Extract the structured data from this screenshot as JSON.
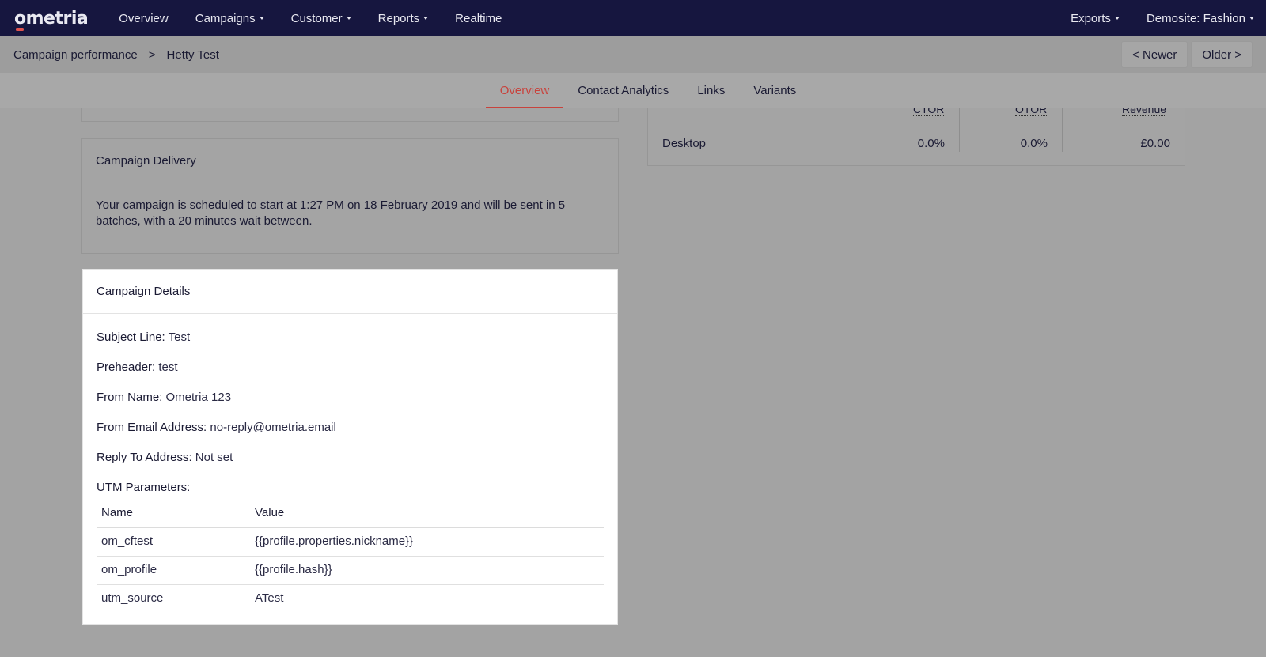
{
  "nav": {
    "logo": "ometria",
    "items": [
      {
        "label": "Overview",
        "dropdown": false
      },
      {
        "label": "Campaigns",
        "dropdown": true
      },
      {
        "label": "Customer",
        "dropdown": true
      },
      {
        "label": "Reports",
        "dropdown": true
      },
      {
        "label": "Realtime",
        "dropdown": false
      }
    ],
    "right": [
      {
        "label": "Exports",
        "dropdown": true
      },
      {
        "label": "Demosite: Fashion",
        "dropdown": true
      }
    ]
  },
  "breadcrumb": {
    "parent": "Campaign performance",
    "separator": ">",
    "current": "Hetty Test"
  },
  "pager": {
    "newer": "< Newer",
    "older": "Older >"
  },
  "tabs": [
    {
      "label": "Overview",
      "active": true
    },
    {
      "label": "Contact Analytics",
      "active": false
    },
    {
      "label": "Links",
      "active": false
    },
    {
      "label": "Variants",
      "active": false
    }
  ],
  "stats": {
    "headers": [
      "CTOR",
      "OTOR",
      "Revenue"
    ],
    "row": {
      "label": "Desktop",
      "ctor": "0.0%",
      "otor": "0.0%",
      "revenue": "£0.00"
    }
  },
  "delivery": {
    "title": "Campaign Delivery",
    "text": "Your campaign is scheduled to start at 1:27 PM on 18 February 2019 and will be sent in 5 batches, with a 20 minutes wait between."
  },
  "details": {
    "title": "Campaign Details",
    "fields": [
      {
        "label": "Subject Line:",
        "value": "Test"
      },
      {
        "label": "Preheader:",
        "value": "test"
      },
      {
        "label": "From Name:",
        "value": "Ometria 123"
      },
      {
        "label": "From Email Address:",
        "value": "no-reply@ometria.email"
      },
      {
        "label": "Reply To Address:",
        "value": "Not set"
      }
    ],
    "utm_label": "UTM Parameters:",
    "utm_headers": [
      "Name",
      "Value"
    ],
    "utm_rows": [
      {
        "name": "om_cftest",
        "value": "{{profile.properties.nickname}}"
      },
      {
        "name": "om_profile",
        "value": "{{profile.hash}}"
      },
      {
        "name": "utm_source",
        "value": "ATest"
      }
    ]
  },
  "colors": {
    "nav_bg": "#16163f",
    "accent": "#c8433d",
    "overlay_gray": "#a3a3a3"
  }
}
